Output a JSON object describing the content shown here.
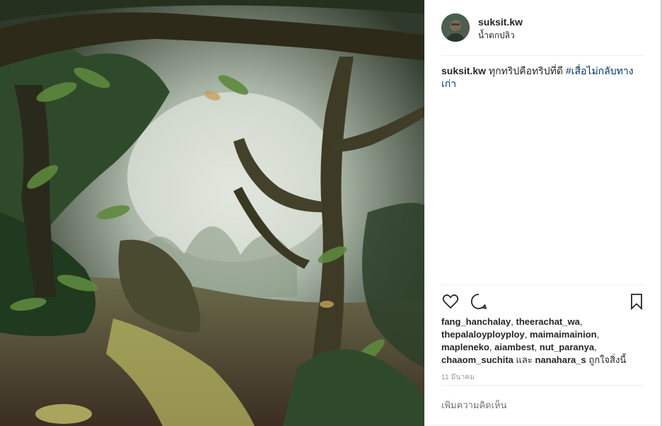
{
  "post": {
    "username": "suksit.kw",
    "location": "น้ำตกปลิว",
    "caption_username": "suksit.kw",
    "caption_text": "ทุกทริปคือทริปที่ดี",
    "hashtag": "#เสื่อไม่กลับทางเก่า",
    "likes": {
      "users": [
        "fang_hanchalay",
        "theerachat_wa",
        "thepalaloyployploy",
        "maimaimainion",
        "mapleneko",
        "aiambest",
        "nut_paranya",
        "chaaom_suchita"
      ],
      "last_user": "nanahara_s",
      "and_word": "และ",
      "suffix": "ถูกใจสิ่งนี้"
    },
    "date": "11 มีนาคม",
    "comment_placeholder": "เพิ่มความคิดเห็น"
  },
  "icons": {
    "like": "heart-icon",
    "comment": "comment-icon",
    "save": "bookmark-icon"
  },
  "colors": {
    "text": "#262626",
    "hashtag": "#003569",
    "muted": "#999999",
    "divider": "#efefef"
  }
}
